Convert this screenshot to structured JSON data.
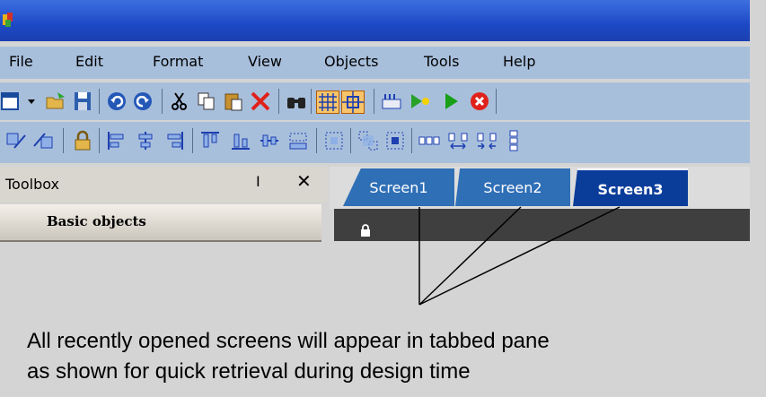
{
  "menu": {
    "items": [
      {
        "label": "File"
      },
      {
        "label": "Edit"
      },
      {
        "label": "Format"
      },
      {
        "label": "View"
      },
      {
        "label": "Objects"
      },
      {
        "label": "Tools"
      },
      {
        "label": "Help"
      }
    ]
  },
  "toolbox": {
    "title": "Toolbox",
    "pin_glyph": "I",
    "close_glyph": "✕",
    "section_label": "Basic objects"
  },
  "tabs": [
    {
      "label": "Screen1",
      "active": false
    },
    {
      "label": "Screen2",
      "active": false
    },
    {
      "label": "Screen3",
      "active": true
    }
  ],
  "caption": {
    "line1": "All recently opened screens will appear in tabbed pane",
    "line2": "as shown for quick retrieval during design time"
  },
  "colors": {
    "titlebar": "#1d49c6",
    "toolbar": "#a8bfdc",
    "tab_inactive": "#2f6fb6",
    "tab_active": "#0a3c9a"
  },
  "toolbar_icons": {
    "row1": [
      "new-screen-icon",
      "dropdown-arrow-icon",
      "open-folder-icon",
      "save-icon",
      "undo-icon",
      "redo-icon",
      "cut-icon",
      "copy-icon",
      "paste-icon",
      "delete-icon",
      "find-icon",
      "grid-icon",
      "snap-grid-icon",
      "build-icon",
      "run-icon",
      "play-icon",
      "stop-icon"
    ],
    "row2": [
      "bring-front-icon",
      "send-back-icon",
      "lock-icon",
      "align-left-icon",
      "align-center-icon",
      "align-right-icon",
      "align-top-icon",
      "align-middle-icon",
      "align-bottom-icon",
      "same-size-icon",
      "group-icon",
      "ungroup-icon",
      "center-icon",
      "space-horizontal-icon",
      "space-h-increase-icon",
      "space-h-decrease-icon",
      "space-vertical-icon"
    ]
  }
}
